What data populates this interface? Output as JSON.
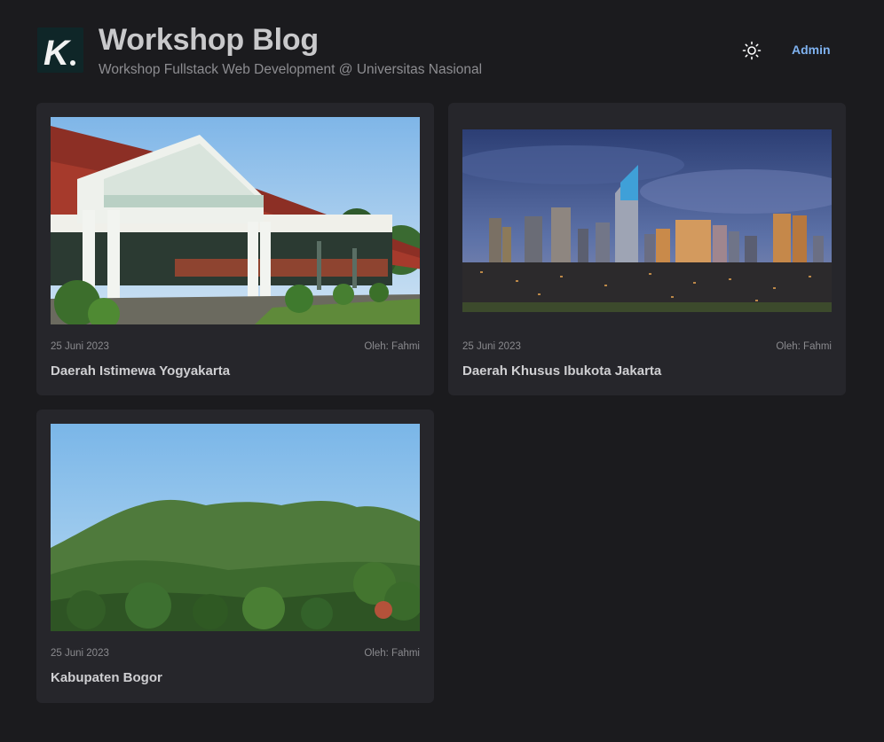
{
  "header": {
    "logo_letter": "K",
    "title": "Workshop Blog",
    "subtitle": "Workshop Fullstack Web Development @ Universitas Nasional",
    "theme_icon": "sun-icon",
    "admin_label": "Admin"
  },
  "colors": {
    "background": "#1b1b1e",
    "card": "#26262b",
    "accent_link": "#7fb2f0"
  },
  "posts": [
    {
      "date": "25 Juni 2023",
      "author": "Oleh: Fahmi",
      "title": "Daerah Istimewa Yogyakarta",
      "image": "kraton-pavilion-photo"
    },
    {
      "date": "25 Juni 2023",
      "author": "Oleh: Fahmi",
      "title": "Daerah Khusus Ibukota Jakarta",
      "image": "jakarta-skyline-photo"
    },
    {
      "date": "25 Juni 2023",
      "author": "Oleh: Fahmi",
      "title": "Kabupaten Bogor",
      "image": "mountain-forest-photo"
    }
  ]
}
